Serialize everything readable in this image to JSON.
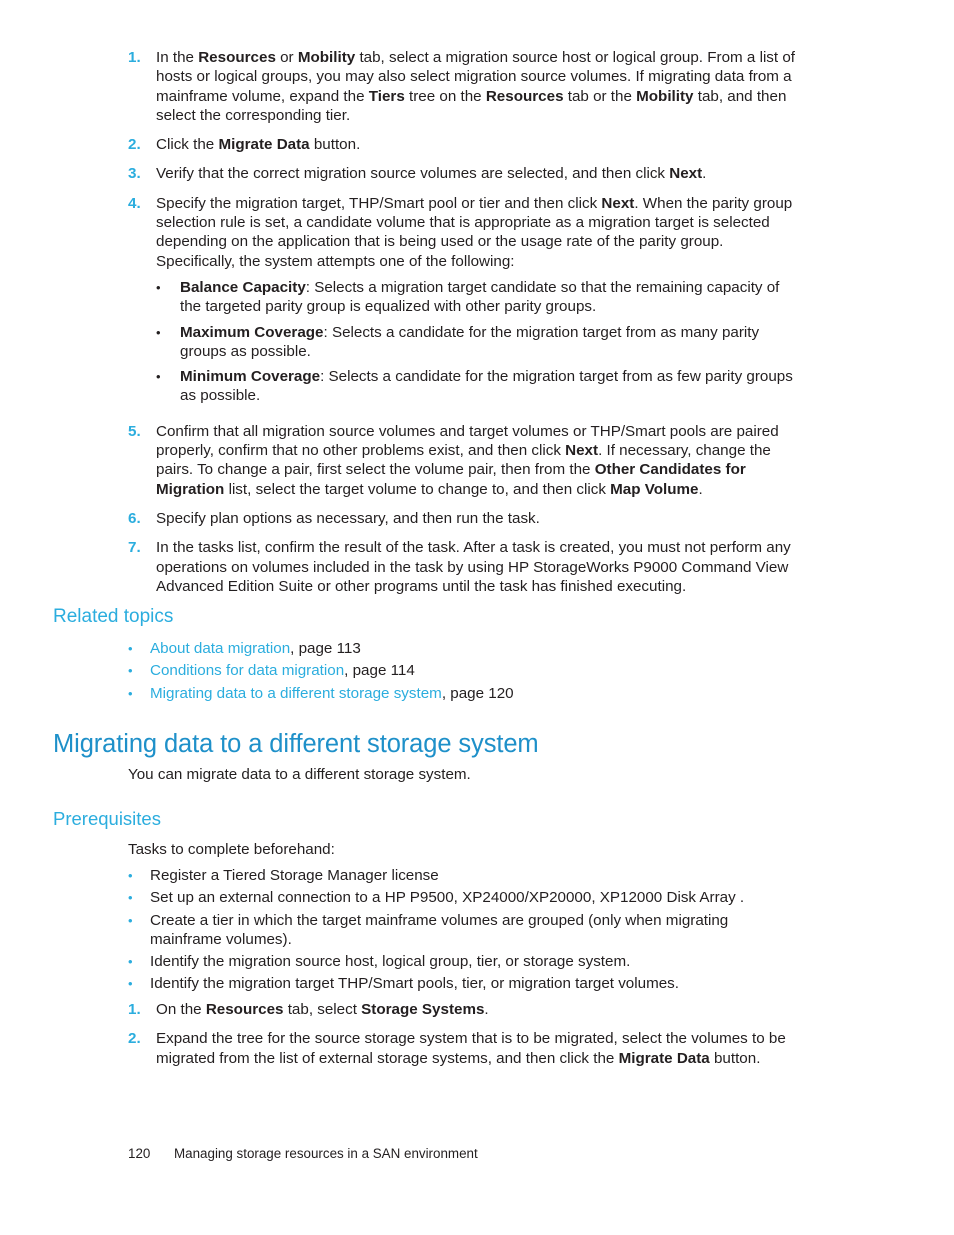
{
  "document": {
    "title_heading": "Migrating data to a different storage system",
    "intro_paragraph": "You can migrate data to a different storage system.",
    "related_topics_heading": "Related topics",
    "prerequisites_heading": "Prerequisites",
    "prerequisites_intro": "Tasks to complete beforehand:"
  },
  "colors": {
    "accent_blue": "#2badde",
    "heading_blue": "#1e90c9",
    "body_black": "#231f20"
  },
  "procedure_steps": [
    {
      "number": "1.",
      "parts": [
        {
          "t": "In the ",
          "b": false
        },
        {
          "t": "Resources",
          "b": true
        },
        {
          "t": " or ",
          "b": false
        },
        {
          "t": "Mobility",
          "b": true
        },
        {
          "t": " tab, select a migration source host or logical group. From a list of hosts or logical groups, you may also select migration source volumes. If migrating data from a mainframe volume, expand the ",
          "b": false
        },
        {
          "t": "Tiers",
          "b": true
        },
        {
          "t": " tree on the ",
          "b": false
        },
        {
          "t": "Resources",
          "b": true
        },
        {
          "t": " tab or the ",
          "b": false
        },
        {
          "t": "Mobility",
          "b": true
        },
        {
          "t": " tab, and then select the corresponding tier.",
          "b": false
        }
      ]
    },
    {
      "number": "2.",
      "parts": [
        {
          "t": "Click the ",
          "b": false
        },
        {
          "t": "Migrate Data",
          "b": true
        },
        {
          "t": " button.",
          "b": false
        }
      ]
    },
    {
      "number": "3.",
      "parts": [
        {
          "t": "Verify that the correct migration source volumes are selected, and then click ",
          "b": false
        },
        {
          "t": "Next",
          "b": true
        },
        {
          "t": ".",
          "b": false
        }
      ]
    },
    {
      "number": "4.",
      "parts": [
        {
          "t": "Specify the migration target, THP/Smart pool or tier and then click ",
          "b": false
        },
        {
          "t": "Next",
          "b": true
        },
        {
          "t": ". When the parity group selection rule is set, a candidate volume that is appropriate as a migration target is selected depending on the application that is being used or the usage rate of the parity group. Specifically, the system attempts one of the following:",
          "b": false
        }
      ],
      "sub_bullets": [
        {
          "parts": [
            {
              "t": "Balance Capacity",
              "b": true
            },
            {
              "t": ": Selects a migration target candidate so that the remaining capacity of the targeted parity group is equalized with other parity groups.",
              "b": false
            }
          ]
        },
        {
          "parts": [
            {
              "t": "Maximum Coverage",
              "b": true
            },
            {
              "t": ": Selects a candidate for the migration target from as many parity groups as possible.",
              "b": false
            }
          ]
        },
        {
          "parts": [
            {
              "t": "Minimum Coverage",
              "b": true
            },
            {
              "t": ": Selects a candidate for the migration target from as few parity groups as possible.",
              "b": false
            }
          ]
        }
      ]
    },
    {
      "number": "5.",
      "parts": [
        {
          "t": "Confirm that all migration source volumes and target volumes or THP/Smart pools are paired properly, confirm that no other problems exist, and then click ",
          "b": false
        },
        {
          "t": "Next",
          "b": true
        },
        {
          "t": ". If necessary, change the pairs. To change a pair, first select the volume pair, then from the ",
          "b": false
        },
        {
          "t": "Other Candidates for Migration",
          "b": true
        },
        {
          "t": " list, select the target volume to change to, and then click ",
          "b": false
        },
        {
          "t": "Map Volume",
          "b": true
        },
        {
          "t": ".",
          "b": false
        }
      ]
    },
    {
      "number": "6.",
      "parts": [
        {
          "t": "Specify plan options as necessary, and then run the task.",
          "b": false
        }
      ]
    },
    {
      "number": "7.",
      "parts": [
        {
          "t": "In the tasks list, confirm the result of the task. After a task is created, you must not perform any operations on volumes included in the task by using HP StorageWorks P9000 Command View Advanced Edition Suite or other programs until the task has finished executing.",
          "b": false
        }
      ]
    }
  ],
  "related_topics": [
    {
      "link": "About data migration",
      "suffix": ", page 113"
    },
    {
      "link": "Conditions for data migration",
      "suffix": ", page 114"
    },
    {
      "link": "Migrating data to a different storage system",
      "suffix": ", page 120"
    }
  ],
  "prerequisite_bullets": [
    {
      "parts": [
        {
          "t": "Register a Tiered Storage Manager license",
          "b": false
        }
      ]
    },
    {
      "parts": [
        {
          "t": "Set up an external connection to a HP P9500, XP24000/XP20000, XP12000 Disk Array .",
          "b": false
        }
      ]
    },
    {
      "parts": [
        {
          "t": "Create a tier in which the target mainframe volumes are grouped (only when migrating mainframe volumes).",
          "b": false
        }
      ]
    },
    {
      "parts": [
        {
          "t": "Identify the migration source host, logical group, tier, or storage system.",
          "b": false
        }
      ]
    },
    {
      "parts": [
        {
          "t": "Identify the migration target THP/Smart pools, tier, or migration target volumes.",
          "b": false
        }
      ]
    }
  ],
  "prerequisite_steps": [
    {
      "number": "1.",
      "parts": [
        {
          "t": "On the ",
          "b": false
        },
        {
          "t": "Resources",
          "b": true
        },
        {
          "t": " tab, select ",
          "b": false
        },
        {
          "t": "Storage Systems",
          "b": true
        },
        {
          "t": ".",
          "b": false
        }
      ]
    },
    {
      "number": "2.",
      "parts": [
        {
          "t": "Expand the tree for the source storage system that is to be migrated, select the volumes to be migrated from the list of external storage systems, and then click the ",
          "b": false
        },
        {
          "t": "Migrate Data",
          "b": true
        },
        {
          "t": " button.",
          "b": false
        }
      ]
    }
  ],
  "footer": {
    "page_number": "120",
    "chapter_title": "Managing storage resources in a SAN environment"
  },
  "icons": {
    "bullet_glyph": "•"
  }
}
